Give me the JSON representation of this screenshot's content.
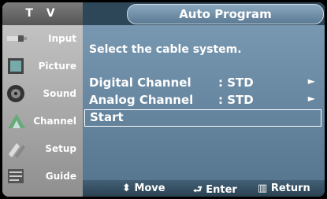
{
  "sidebar": {
    "header": "T V",
    "items": [
      {
        "label": "Input",
        "icon": "input-plug-icon"
      },
      {
        "label": "Picture",
        "icon": "picture-icon"
      },
      {
        "label": "Sound",
        "icon": "speaker-icon"
      },
      {
        "label": "Channel",
        "icon": "channel-icon"
      },
      {
        "label": "Setup",
        "icon": "setup-icon"
      },
      {
        "label": "Guide",
        "icon": "guide-icon"
      }
    ]
  },
  "header": {
    "title": "Auto Program"
  },
  "main": {
    "instruction": "Select the cable system.",
    "rows": [
      {
        "name": "Digital Channel",
        "value": ": STD",
        "arrow": "►"
      },
      {
        "name": "Analog Channel",
        "value": ": STD",
        "arrow": "►"
      },
      {
        "name": "Start"
      }
    ]
  },
  "footer": {
    "move": "Move",
    "enter": "Enter",
    "return": "Return"
  },
  "colors": {
    "panel": "#6f8fa8",
    "title_pill": "#6d8aa1",
    "topbar": "#2d4658",
    "sidebar": "#b0b0b0"
  }
}
